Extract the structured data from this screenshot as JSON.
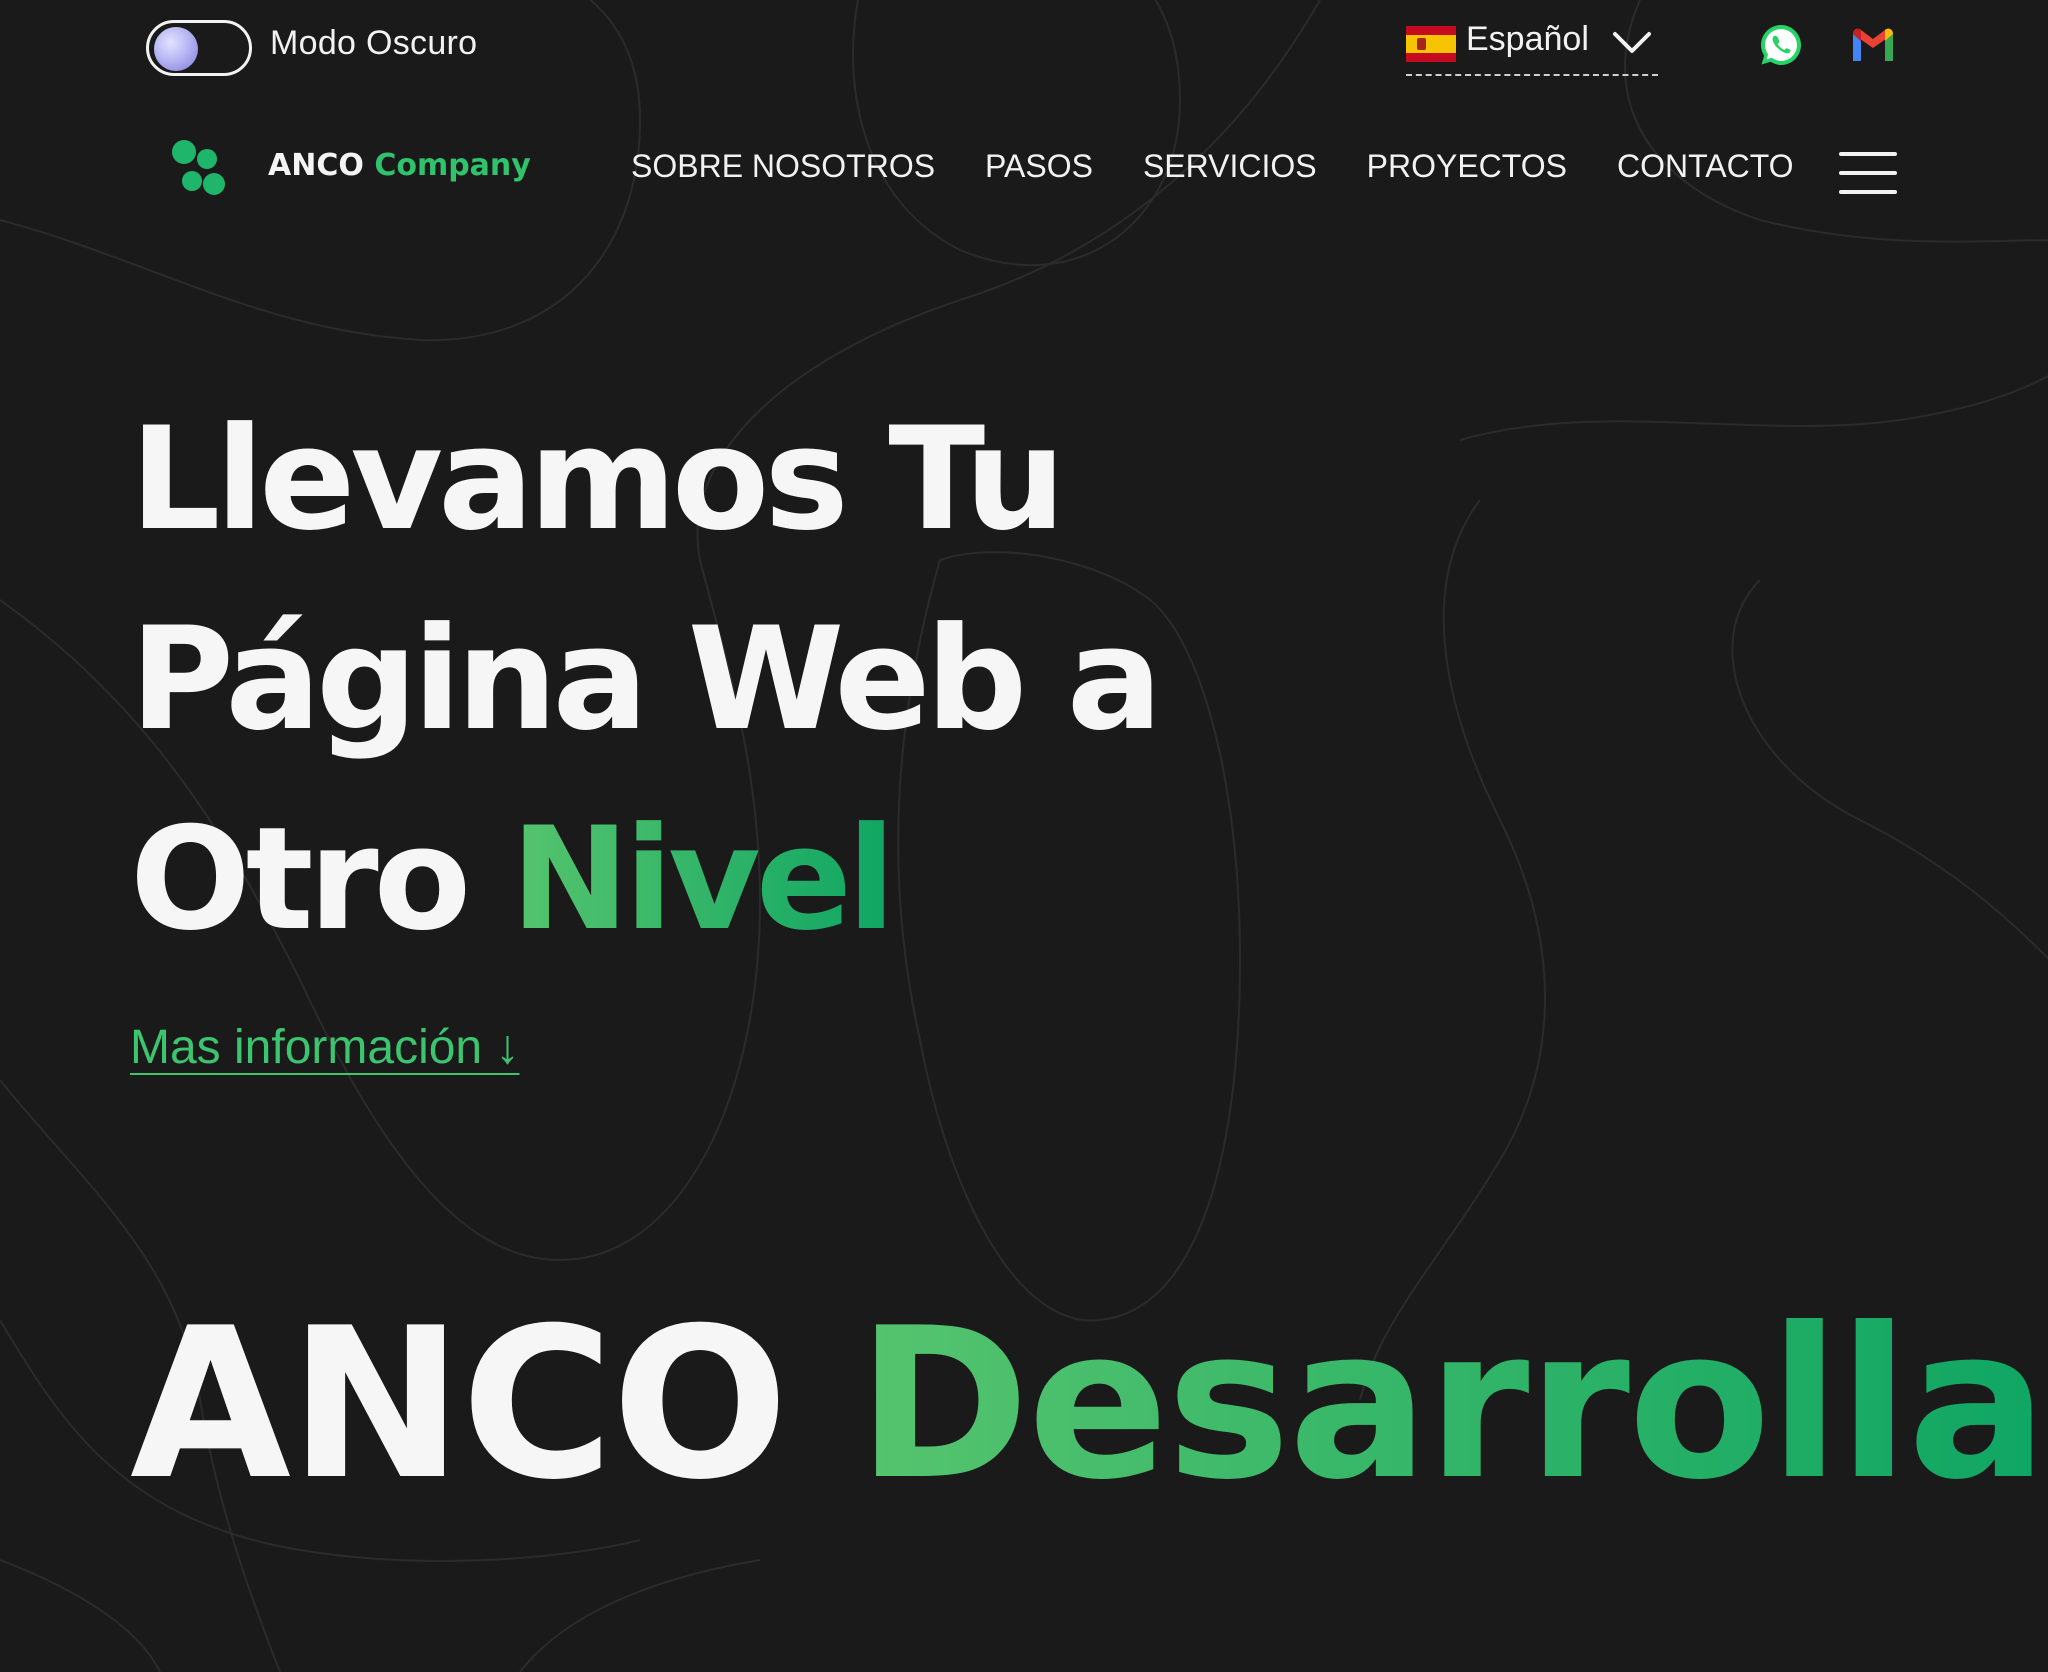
{
  "topbar": {
    "dark_mode_label": "Modo Oscuro",
    "language": {
      "label": "Español",
      "flag": "es-flag-icon"
    },
    "social": [
      {
        "name": "whatsapp",
        "icon": "whatsapp-icon",
        "color": "#25d366"
      },
      {
        "name": "gmail",
        "icon": "gmail-icon"
      }
    ]
  },
  "navbar": {
    "brand_name": "ANCO",
    "brand_suffix": "Company",
    "items": [
      {
        "label": "SOBRE NOSOTROS"
      },
      {
        "label": "PASOS"
      },
      {
        "label": "SERVICIOS"
      },
      {
        "label": "PROYECTOS"
      },
      {
        "label": "CONTACTO"
      }
    ],
    "menu_icon": "hamburger-menu-icon"
  },
  "hero": {
    "headline_line1": "Llevamos Tu",
    "headline_line2": "Página Web a",
    "headline_line3_plain": "Otro",
    "headline_line3_accent": "Nivel",
    "more_link": "Mas información ↓"
  },
  "banner": {
    "word1": "ANCO",
    "word2": "Desarrolla"
  },
  "colors": {
    "background": "#1a1a1b",
    "accent_start": "#56c46e",
    "accent_end": "#0fa663",
    "text": "#f6f6f6"
  }
}
